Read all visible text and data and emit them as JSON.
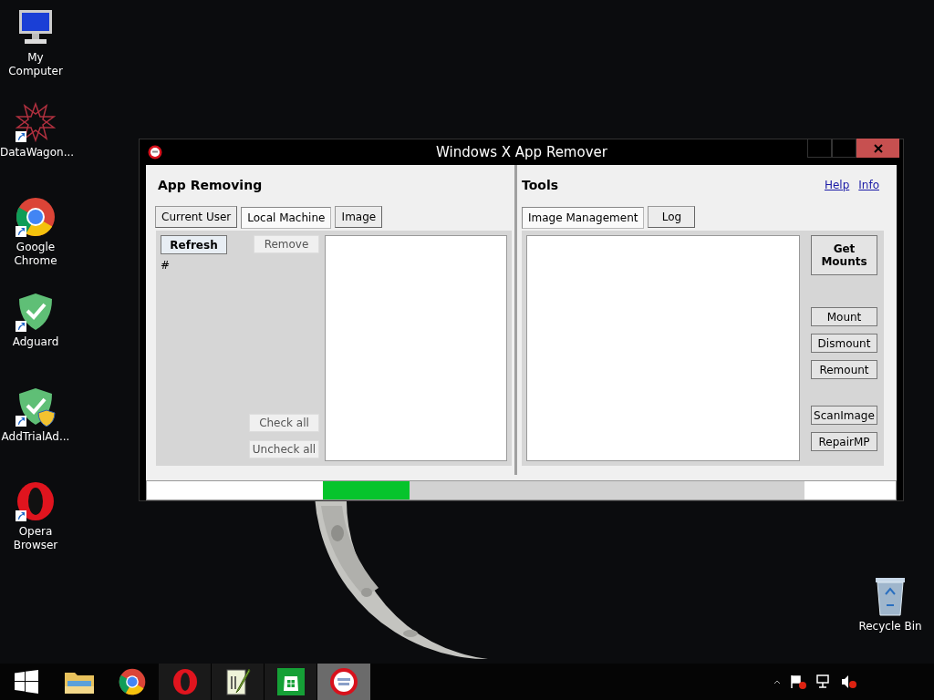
{
  "desktop_icons": [
    {
      "label": "My Computer",
      "kind": "computer",
      "shortcut": false
    },
    {
      "label": "DataWagon...",
      "kind": "star",
      "shortcut": true
    },
    {
      "label": "Google Chrome",
      "kind": "chrome",
      "shortcut": true
    },
    {
      "label": "Adguard",
      "kind": "shield",
      "shortcut": true
    },
    {
      "label": "AddTrialAd...",
      "kind": "shield-uac",
      "shortcut": true
    },
    {
      "label": "Opera Browser",
      "kind": "opera",
      "shortcut": true
    }
  ],
  "recycle_bin": {
    "label": "Recycle Bin"
  },
  "window": {
    "title": "Windows X App Remover",
    "left": {
      "heading": "App Removing",
      "tabs": [
        {
          "label": "Current User",
          "selected": false
        },
        {
          "label": "Local Machine",
          "selected": true
        },
        {
          "label": "Image",
          "selected": false
        }
      ],
      "refresh": "Refresh",
      "count": "#",
      "remove": "Remove",
      "check_all": "Check all",
      "uncheck_all": "Uncheck all"
    },
    "right": {
      "heading": "Tools",
      "links": [
        "Help",
        "Info"
      ],
      "tabs": [
        {
          "label": "Image Management",
          "selected": true
        },
        {
          "label": "Log",
          "selected": false
        }
      ],
      "buttons": [
        {
          "label": "Get Mounts",
          "kind": "primary"
        },
        {
          "label": "Mount",
          "kind": "plain"
        },
        {
          "label": "Dismount",
          "kind": "plain"
        },
        {
          "label": "Remount",
          "kind": "plain"
        },
        {
          "label": "ScanImage",
          "kind": "plain"
        },
        {
          "label": "RepairMP",
          "kind": "plain"
        }
      ]
    },
    "progress": {
      "level": 0.18
    }
  },
  "taskbar": {
    "items": [
      {
        "kind": "start",
        "selected": false
      },
      {
        "kind": "folder",
        "selected": false
      },
      {
        "kind": "chrome",
        "selected": false
      },
      {
        "kind": "opera",
        "selected": false
      },
      {
        "kind": "notepad",
        "selected": false
      },
      {
        "kind": "store",
        "selected": false
      },
      {
        "kind": "app",
        "selected": true
      }
    ]
  }
}
